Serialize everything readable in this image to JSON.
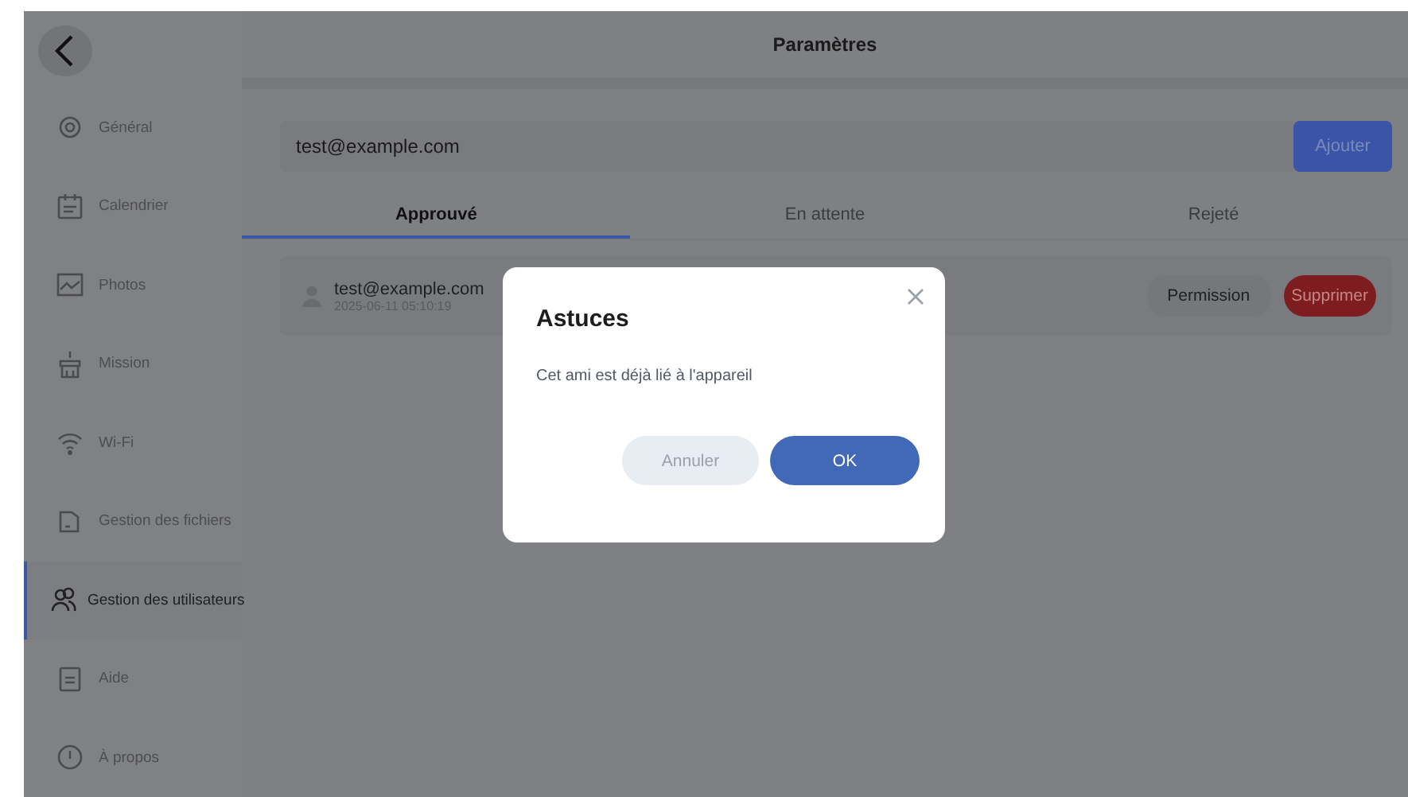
{
  "header": {
    "title": "Paramètres"
  },
  "sidebar": {
    "items": [
      {
        "label": "Général",
        "kind": "gear",
        "selected": false
      },
      {
        "label": "Calendrier",
        "kind": "calendar",
        "selected": false
      },
      {
        "label": "Photos",
        "kind": "photo",
        "selected": false
      },
      {
        "label": "Mission",
        "kind": "mission",
        "selected": false
      },
      {
        "label": "Wi-Fi",
        "kind": "wifi",
        "selected": false
      },
      {
        "label": "Gestion des fichiers",
        "kind": "folder",
        "selected": false
      },
      {
        "label": "Gestion des utilisateurs",
        "kind": "users",
        "selected": true
      },
      {
        "label": "Aide",
        "kind": "doc",
        "selected": false
      },
      {
        "label": "À propos",
        "kind": "info",
        "selected": false
      }
    ]
  },
  "add_user": {
    "value": "test@example.com",
    "button": "Ajouter"
  },
  "tabs": [
    {
      "label": "Approuvé",
      "selected": true
    },
    {
      "label": "En attente",
      "selected": false
    },
    {
      "label": "Rejeté",
      "selected": false
    }
  ],
  "users": [
    {
      "email": "test@example.com",
      "date": "2025-06-11 05:10:19",
      "permission": "Permission",
      "delete": "Supprimer"
    }
  ],
  "dialog": {
    "title": "Astuces",
    "message": "Cet ami est déjà lié à l'appareil",
    "cancel": "Annuler",
    "ok": "OK"
  }
}
